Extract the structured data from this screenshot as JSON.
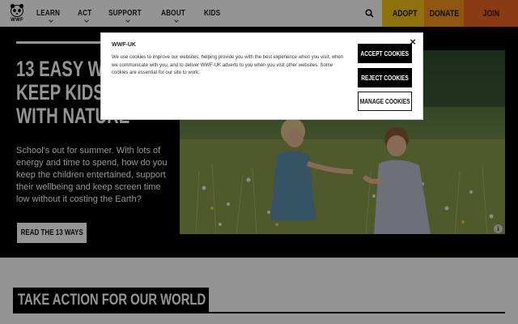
{
  "nav": {
    "logo_text": "WWF",
    "links": [
      {
        "label": "LEARN"
      },
      {
        "label": "ACT"
      },
      {
        "label": "SUPPORT"
      },
      {
        "label": "ABOUT"
      },
      {
        "label": "KIDS"
      }
    ],
    "search_icon": "search-icon",
    "adopt_label": "ADOPT",
    "donate_label": "DONATE",
    "join_label": "JOIN"
  },
  "hero": {
    "title_lines": [
      "13 EASY WAYS TO",
      "KEEP KIDS BUSY",
      "WITH NATURE"
    ],
    "text": "School's out for summer. With lots of energy and time to spend, how do you keep the children entertained, support their wellbeing and keep screen time low without it costing the Earth?",
    "button_label": "READ THE 13 WAYS",
    "info_icon_glyph": "i"
  },
  "section": {
    "title": "TAKE ACTION FOR OUR WORLD"
  },
  "cookie": {
    "title": "WWF-UK",
    "body": "We use cookies to improve our websites, helping provide you with the best experience when you visit, when we communicate with you, and to deliver WWF-UK adverts to you when you visit other websites. Some cookies are essential for our site to work.",
    "accept_label": "ACCEPT COOKIES",
    "reject_label": "REJECT COOKIES",
    "manage_label": "MANAGE COOKIES",
    "close_glyph": "×"
  },
  "colors": {
    "adopt": "#f6c21a",
    "donate": "#f7931e",
    "join": "#ee6423",
    "hero_bg": "#000000"
  }
}
